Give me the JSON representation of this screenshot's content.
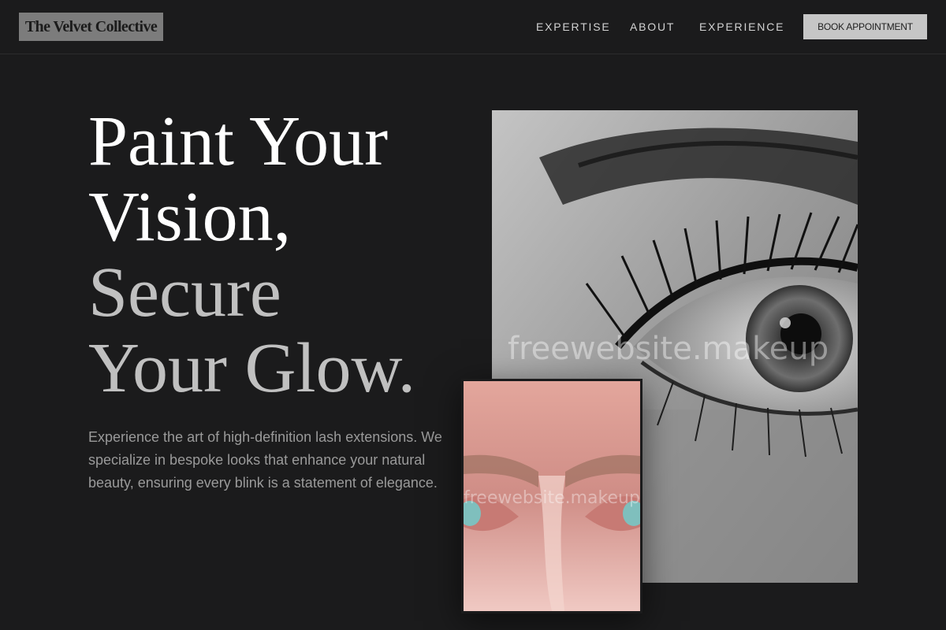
{
  "brand": {
    "name": "The Velvet Collective"
  },
  "nav": {
    "items": [
      {
        "label": "EXPERTISE"
      },
      {
        "label": "ABOUT"
      },
      {
        "label": "EXPERIENCE"
      }
    ],
    "cta_label": "BOOK APPOINTMENT"
  },
  "hero": {
    "title_line1": "Paint Your",
    "title_line2": "Vision,",
    "title_line3": "Secure",
    "title_line4": "Your Glow.",
    "description": "Experience the art of high-definition lash extensions. We specialize in bespoke looks that enhance your natural beauty, ensuring every blink is a statement of elegance."
  },
  "images": {
    "main_watermark": "freewebsite.makeup",
    "small_watermark": "freewebsite.makeup"
  },
  "colors": {
    "background": "#1b1b1c",
    "accent_button": "#c6c6c6",
    "logo_bg": "#7c7c7c"
  }
}
